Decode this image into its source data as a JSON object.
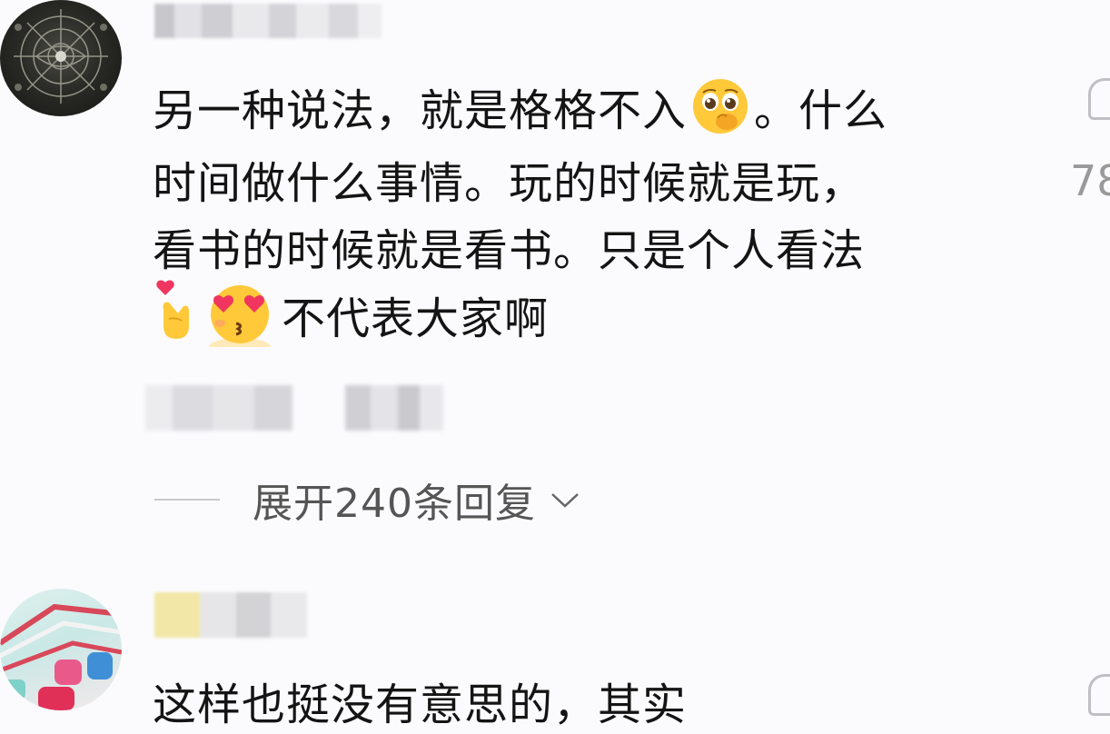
{
  "comments": [
    {
      "avatar_icon": "avatar-icon",
      "lines": [
        {
          "segments": [
            "另一种说法，就是格格不入",
            "。什么"
          ]
        },
        {
          "segments": [
            "时间做什么事情。玩的时候就是玩，"
          ]
        },
        {
          "segments": [
            "看书的时候就是看书。只是个人看法"
          ]
        },
        {
          "segments": [
            "不代表大家啊"
          ]
        }
      ],
      "emojis": [
        "pleading-face-icon",
        "heart-hand-icon",
        "heart-eyes-kiss-icon"
      ],
      "replies_label": "展开240条回复",
      "like_count": "78"
    },
    {
      "avatar_icon": "avatar-icon",
      "lines": [
        {
          "segments": [
            "这样也挺没有意思的，其实"
          ]
        }
      ]
    }
  ],
  "colors": {
    "background": "#fbfbfd",
    "text": "#141414",
    "secondary_text": "#555555",
    "muted": "#999999"
  }
}
